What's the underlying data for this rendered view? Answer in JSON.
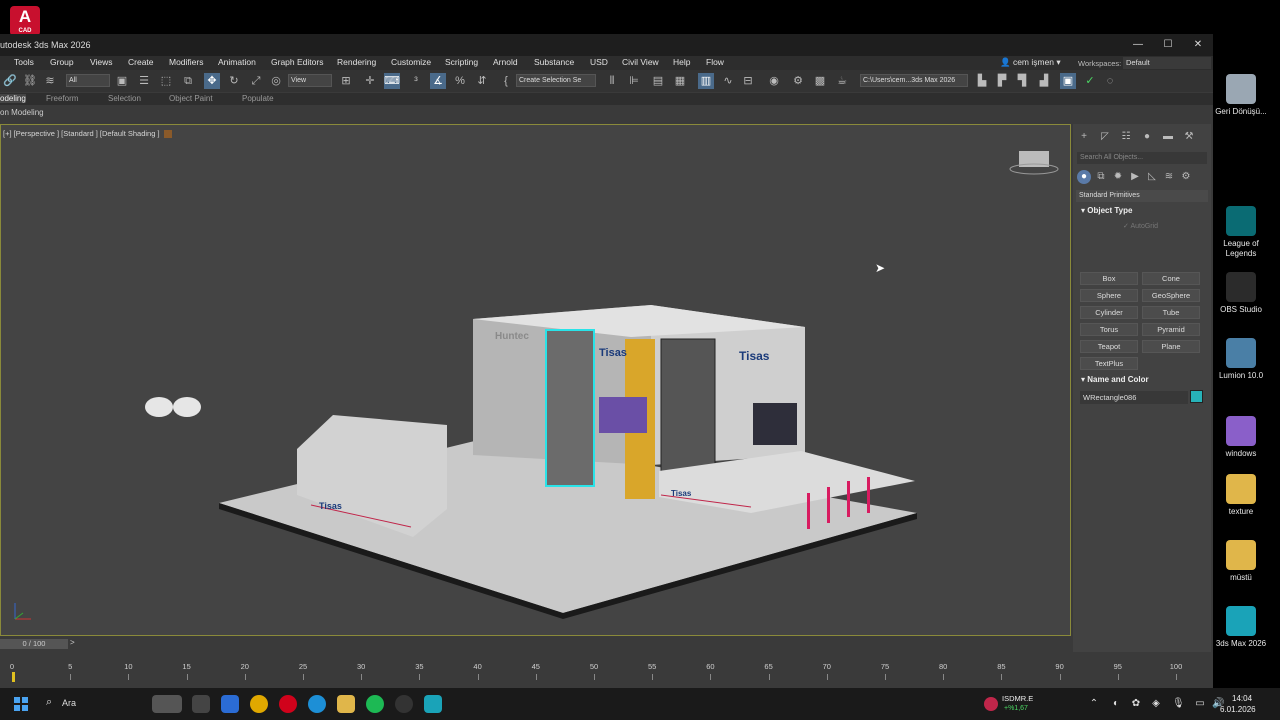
{
  "window": {
    "title": "utodesk 3ds Max 2026",
    "minimize": "—",
    "maximize": "☐",
    "close": "✕"
  },
  "desktop_app_icon": {
    "letter": "A",
    "sub": "CAD"
  },
  "menu": [
    "Tools",
    "Group",
    "Views",
    "Create",
    "Modifiers",
    "Animation",
    "Graph Editors",
    "Rendering",
    "Customize",
    "Scripting",
    "Arnold",
    "Substance",
    "USD",
    "Civil View",
    "Help",
    "Flow"
  ],
  "user": "cem işmen",
  "workspaces_label": "Workspaces:",
  "workspace": "Default",
  "toolbar": {
    "selection_filter": "All",
    "ref_coord": "View",
    "named_selection": "Create Selection Se",
    "project_path": "C:\\Users\\cem...3ds Max 2026"
  },
  "ribbon_tabs": [
    "odeling",
    "Freeform",
    "Selection",
    "Object Paint",
    "Populate"
  ],
  "ribbon_sub": "on Modeling",
  "viewport": {
    "label": "[+] [Perspective ] [Standard ] [Default Shading ]"
  },
  "command_panel": {
    "search_placeholder": "Search All Objects...",
    "category": "Standard Primitives",
    "object_type_title": "Object Type",
    "autogrid": "AutoGrid",
    "primitives": [
      "Box",
      "Cone",
      "Sphere",
      "GeoSphere",
      "Cylinder",
      "Tube",
      "Torus",
      "Pyramid",
      "Teapot",
      "Plane",
      "TextPlus"
    ],
    "name_color_title": "Name and Color",
    "object_name": "WRectangle086",
    "object_color": "#27b2b8"
  },
  "booth": {
    "brand": "Tisas",
    "side_brand": "Huntec"
  },
  "timeslider": {
    "label": "0 / 100",
    "current_frame": 0,
    "total_frames": 100
  },
  "trackbar": {
    "ticks": [
      0,
      5,
      10,
      15,
      20,
      25,
      30,
      35,
      40,
      45,
      50,
      55,
      60,
      65,
      70,
      75,
      80,
      85,
      90,
      95,
      100
    ]
  },
  "desktop_icons": [
    {
      "label": "Geri Dönüşü...",
      "color": "#9aa7b3"
    },
    {
      "label": "League of Legends",
      "color": "#0a6b73"
    },
    {
      "label": "OBS Studio",
      "color": "#2b2b2b"
    },
    {
      "label": "Lumion 10.0",
      "color": "#4a7fa6"
    },
    {
      "label": "windows",
      "color": "#8a5fc9"
    },
    {
      "label": "texture",
      "color": "#e0b64a"
    },
    {
      "label": "müstü",
      "color": "#e0b64a"
    },
    {
      "label": "3ds Max 2026",
      "color": "#1aa3b8"
    }
  ],
  "taskbar": {
    "search": "Ara",
    "stock_name": "ISDMR.E",
    "stock_change": "+%1,67",
    "time": "14:04",
    "date": "6.01.2026"
  }
}
